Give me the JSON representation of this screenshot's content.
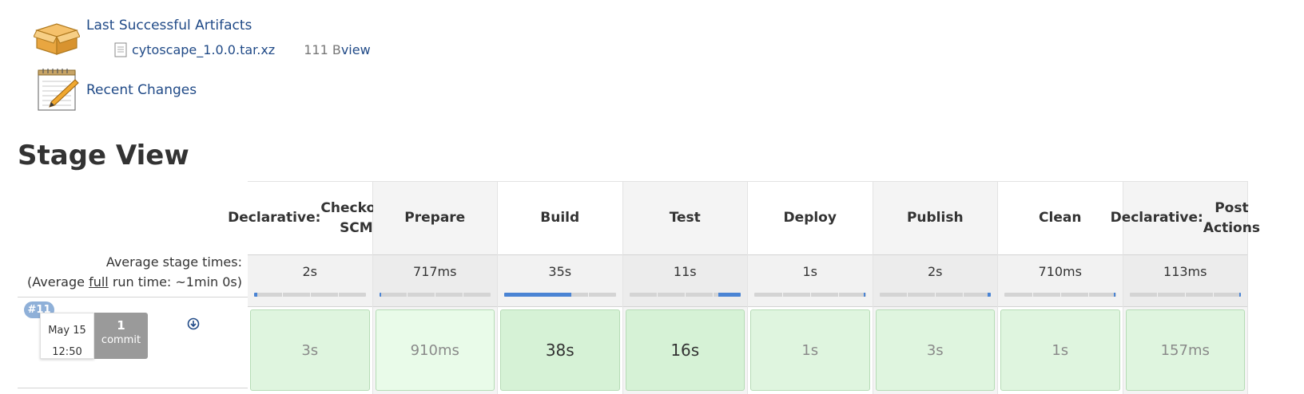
{
  "artifacts": {
    "title": "Last Successful Artifacts",
    "files": [
      {
        "name": "cytoscape_1.0.0.tar.xz",
        "size": "111 B",
        "view_label": "view"
      }
    ]
  },
  "changes": {
    "label": "Recent Changes"
  },
  "stage_view": {
    "title": "Stage View",
    "avg_label": "Average stage times:",
    "avg_full_prefix": "(Average ",
    "avg_full_link": "full",
    "avg_full_suffix": " run time: ~1min 0s)",
    "stages": [
      {
        "name_line1": "Declarative:",
        "name_line2": "Checkout SCM",
        "avg": "2s",
        "progress": 0.03,
        "run_value": "3s"
      },
      {
        "name_line1": "Prepare",
        "name_line2": "",
        "avg": "717ms",
        "progress": 0.01,
        "run_value": "910ms"
      },
      {
        "name_line1": "Build",
        "name_line2": "",
        "avg": "35s",
        "progress": 0.6,
        "run_value": "38s"
      },
      {
        "name_line1": "Test",
        "name_line2": "",
        "avg": "11s",
        "progress": 0.2,
        "run_value": "16s"
      },
      {
        "name_line1": "Deploy",
        "name_line2": "",
        "avg": "1s",
        "progress": 0.02,
        "run_value": "1s"
      },
      {
        "name_line1": "Publish",
        "name_line2": "",
        "avg": "2s",
        "progress": 0.03,
        "run_value": "3s"
      },
      {
        "name_line1": "Clean",
        "name_line2": "",
        "avg": "710ms",
        "progress": 0.01,
        "run_value": "1s"
      },
      {
        "name_line1": "Declarative:",
        "name_line2": "Post Actions",
        "avg": "113ms",
        "progress": 0.005,
        "run_value": "157ms"
      }
    ],
    "runs": [
      {
        "build": "#11",
        "date": "May 15",
        "time": "12:50",
        "commit_count": "1",
        "commit_word": "commit"
      }
    ]
  },
  "colors": {
    "link": "#204a87",
    "success_cell": "#dff5df",
    "progress": "#4a84d4"
  },
  "icons": [
    "artifacts-box-icon",
    "file-icon",
    "notepad-icon",
    "download-icon"
  ]
}
